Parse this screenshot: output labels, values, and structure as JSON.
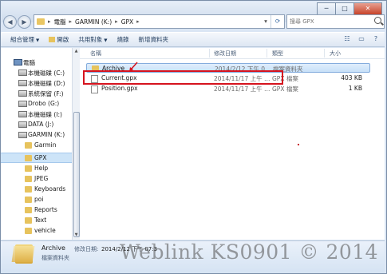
{
  "window": {
    "minimize": "─",
    "maximize": "□",
    "close": "✕"
  },
  "address": {
    "segments": [
      "電腦",
      "GARMIN (K:)",
      "GPX"
    ],
    "chevron": "▸"
  },
  "search": {
    "placeholder": "搜尋 GPX"
  },
  "toolbar": {
    "organize": "組合管理",
    "open": "開啟",
    "share": "共用對象",
    "burn": "燒錄",
    "new_folder": "新增資料夾",
    "dropdown_glyph": "▼"
  },
  "columns": {
    "name": "名稱",
    "date": "修改日期",
    "type": "類型",
    "size": "大小"
  },
  "files": [
    {
      "name": "Archive",
      "date": "2014/2/12 下午 0…",
      "type": "檔案資料夾",
      "size": "",
      "icon": "folder-icon"
    },
    {
      "name": "Current.gpx",
      "date": "2014/11/17 上午 …",
      "type": "GPX 檔案",
      "size": "403 KB",
      "icon": "file-icon"
    },
    {
      "name": "Position.gpx",
      "date": "2014/11/17 上午 …",
      "type": "GPX 檔案",
      "size": "1 KB",
      "icon": "file-icon"
    }
  ],
  "nav": {
    "items": [
      {
        "label": "電腦",
        "icon": "computer",
        "indent": 0
      },
      {
        "label": "本機磁碟 (C:)",
        "icon": "drive",
        "indent": 1
      },
      {
        "label": "本機磁碟 (D:)",
        "icon": "drive",
        "indent": 1
      },
      {
        "label": "系統保留 (F:)",
        "icon": "drive",
        "indent": 1
      },
      {
        "label": "Drobo (G:)",
        "icon": "drive",
        "indent": 1
      },
      {
        "label": "本機磁碟 (I:)",
        "icon": "drive",
        "indent": 1
      },
      {
        "label": "DATA (J:)",
        "icon": "drive",
        "indent": 1
      },
      {
        "label": "GARMIN (K:)",
        "icon": "drive",
        "indent": 1
      },
      {
        "label": "Garmin",
        "icon": "folder",
        "indent": 2
      },
      {
        "label": "GPX",
        "icon": "folder",
        "indent": 2
      },
      {
        "label": "Help",
        "icon": "folder",
        "indent": 2
      },
      {
        "label": "JPEG",
        "icon": "folder",
        "indent": 2
      },
      {
        "label": "Keyboards",
        "icon": "folder",
        "indent": 2
      },
      {
        "label": "poi",
        "icon": "folder",
        "indent": 2
      },
      {
        "label": "Reports",
        "icon": "folder",
        "indent": 2
      },
      {
        "label": "Text",
        "icon": "folder",
        "indent": 2
      },
      {
        "label": "vehicle",
        "icon": "folder",
        "indent": 2
      }
    ]
  },
  "details": {
    "name": "Archive",
    "type": "檔案資料夾",
    "modified_label": "修改日期:",
    "modified_value": "2014/2/12 下午 07:3"
  },
  "watermark": "Weblink KS0901 © 2014",
  "colors": {
    "highlight_box": "#d6131e",
    "selection": "#cde4f8"
  }
}
